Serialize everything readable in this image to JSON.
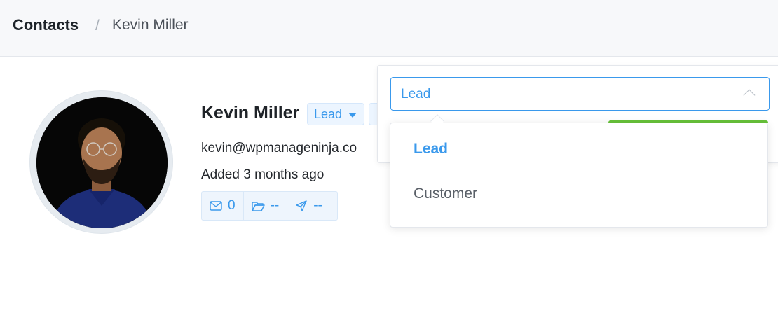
{
  "breadcrumb": {
    "root": "Contacts",
    "separator": "/",
    "current": "Kevin Miller"
  },
  "contact": {
    "name": "Kevin Miller",
    "status": "Lead",
    "email": "kevin@wpmanageninja.co",
    "added": "Added 3 months ago"
  },
  "stats": {
    "emails": "0",
    "lists": "--",
    "campaigns": "--"
  },
  "status_select": {
    "value": "Lead",
    "options": [
      "Lead",
      "Customer"
    ],
    "selected_index": 0
  },
  "icons": {
    "stat_email": "mail-icon",
    "stat_lists": "folder-icon",
    "stat_campaigns": "send-icon",
    "status_caret": "caret-down-icon",
    "select_chevron": "chevron-up-icon"
  },
  "colors": {
    "accent": "#3a99ec",
    "accent_bg": "#ecf5ff",
    "success": "#67c23a",
    "topbar_bg": "#f7f8fa"
  }
}
